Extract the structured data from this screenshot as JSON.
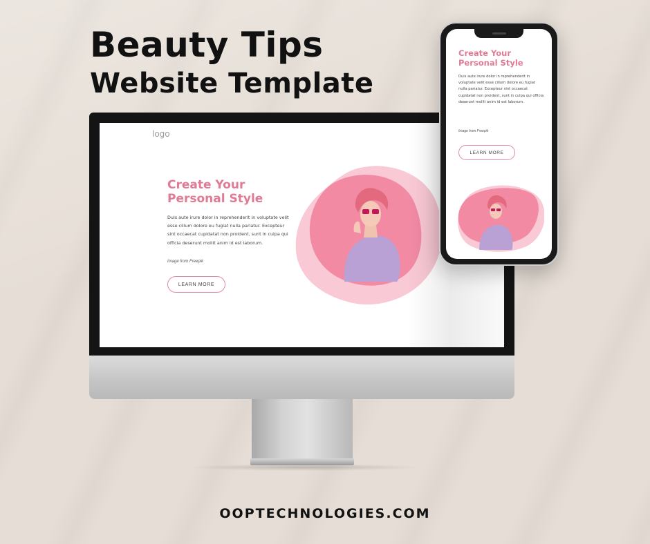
{
  "banner": {
    "title_line1": "Beauty Tips",
    "title_line2": "Website Template",
    "footer_url": "OOPTECHNOLOGIES.COM"
  },
  "desktop_site": {
    "logo": "logo",
    "hero_title": "Create Your Personal Style",
    "hero_body": "Duis aute irure dolor in reprehenderit in voluptate velit esse cillum dolore eu fugiat nulla pariatur. Excepteur sint occaecat cupidatat non proident, sunt in culpa qui officia deserunt mollit anim id est laborum.",
    "image_credit": "Image from Freepik",
    "cta_label": "LEARN MORE"
  },
  "mobile_site": {
    "hero_title": "Create Your Personal Style",
    "hero_body": "Duis aute irure dolor in reprehenderit in voluptate velit esse cillum dolore eu fugiat nulla pariatur. Excepteur sint occaecat cupidatat non proident, sunt in culpa qui officia deserunt mollit anim id est laborum.",
    "image_credit": "Image from Freepik",
    "cta_label": "LEARN MORE"
  },
  "colors": {
    "background": "#e6ded6",
    "accent_pink": "#e07a95",
    "blob_pink": "#f28aa4",
    "blob_light": "#f9c9d5",
    "sweater_lilac": "#b9a1d6"
  }
}
